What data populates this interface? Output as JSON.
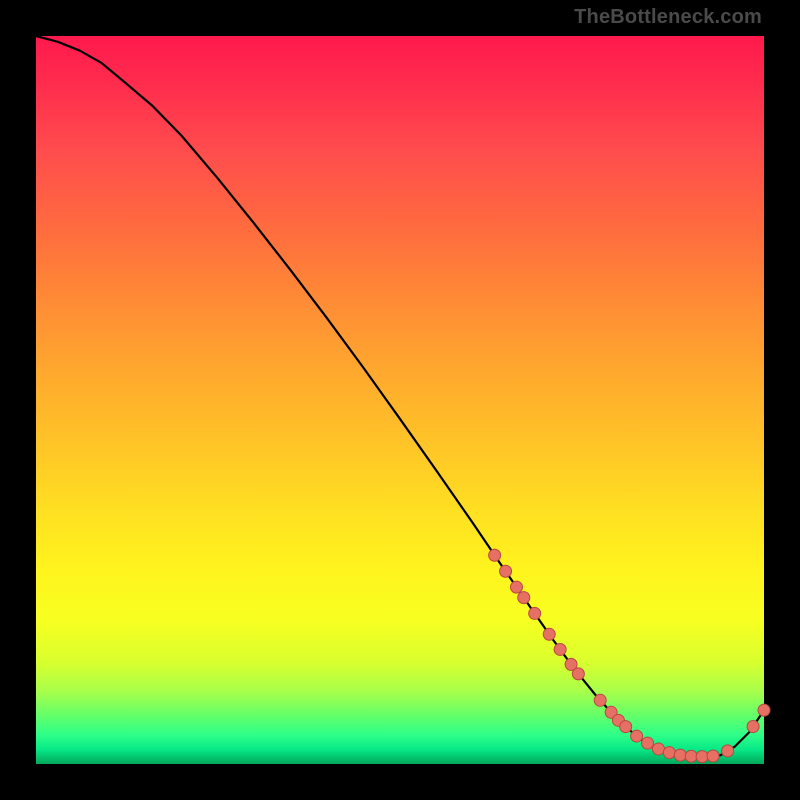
{
  "watermark": "TheBottleneck.com",
  "colors": {
    "frame_bg": "#000000",
    "curve": "#000000",
    "point_fill": "#E77065",
    "point_stroke": "#B8483F"
  },
  "chart_data": {
    "type": "line",
    "title": "",
    "xlabel": "",
    "ylabel": "",
    "xlim": [
      0,
      100
    ],
    "ylim": [
      0,
      100
    ],
    "series": [
      {
        "name": "curve",
        "x": [
          0,
          3,
          6,
          9,
          12,
          16,
          20,
          25,
          30,
          35,
          40,
          45,
          50,
          55,
          60,
          64,
          68,
          71,
          74,
          77,
          80,
          83,
          86,
          89,
          92,
          94,
          96,
          98,
          100
        ],
        "y": [
          100,
          99.2,
          98.0,
          96.3,
          93.8,
          90.4,
          86.3,
          80.4,
          74.2,
          67.8,
          61.2,
          54.4,
          47.4,
          40.3,
          33.1,
          27.2,
          21.4,
          17.1,
          13.0,
          9.3,
          6.0,
          3.4,
          1.8,
          1.1,
          1.0,
          1.2,
          2.4,
          4.4,
          7.4
        ]
      }
    ],
    "points_on_curve_x": [
      63,
      64.5,
      66,
      67,
      68.5,
      70.5,
      72,
      73.5,
      74.5,
      77.5,
      79,
      80,
      81,
      82.5,
      84,
      85.5,
      87,
      88.5,
      90,
      91.5,
      93,
      95,
      98.5,
      100
    ]
  }
}
